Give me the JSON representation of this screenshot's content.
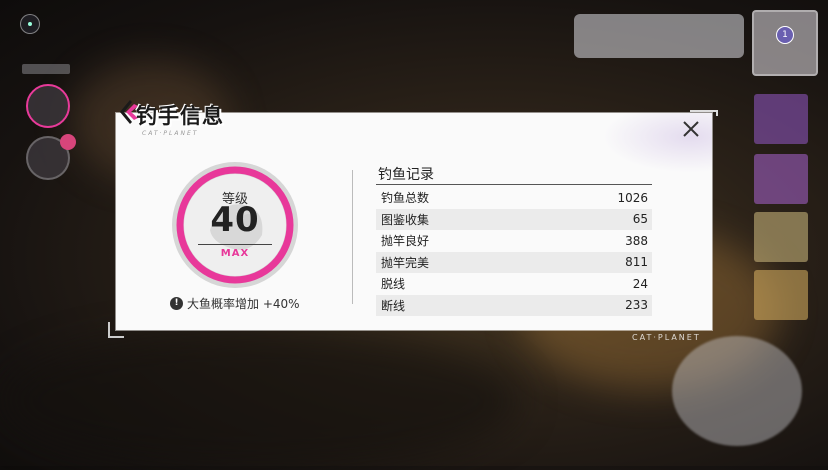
{
  "panel": {
    "title": "钓手信息",
    "subtitle": "CAT·PLANET",
    "brand_footer": "CAT·PLANET"
  },
  "level": {
    "label": "等级",
    "value": "40",
    "max_label": "MAX",
    "ring_color": "#e8389a"
  },
  "bonus": {
    "icon": "!",
    "text": "大鱼概率增加 +40%"
  },
  "records": {
    "title": "钓鱼记录",
    "rows": [
      {
        "label": "钓鱼总数",
        "value": "1026"
      },
      {
        "label": "图鉴收集",
        "value": "65"
      },
      {
        "label": "抛竿良好",
        "value": "388"
      },
      {
        "label": "抛竿完美",
        "value": "811"
      },
      {
        "label": "脱线",
        "value": "24"
      },
      {
        "label": "断线",
        "value": "233"
      }
    ]
  },
  "notifications": {
    "avatar_badge": "1"
  },
  "colors": {
    "accent": "#e8389a",
    "panel_bg": "#fafafa"
  }
}
